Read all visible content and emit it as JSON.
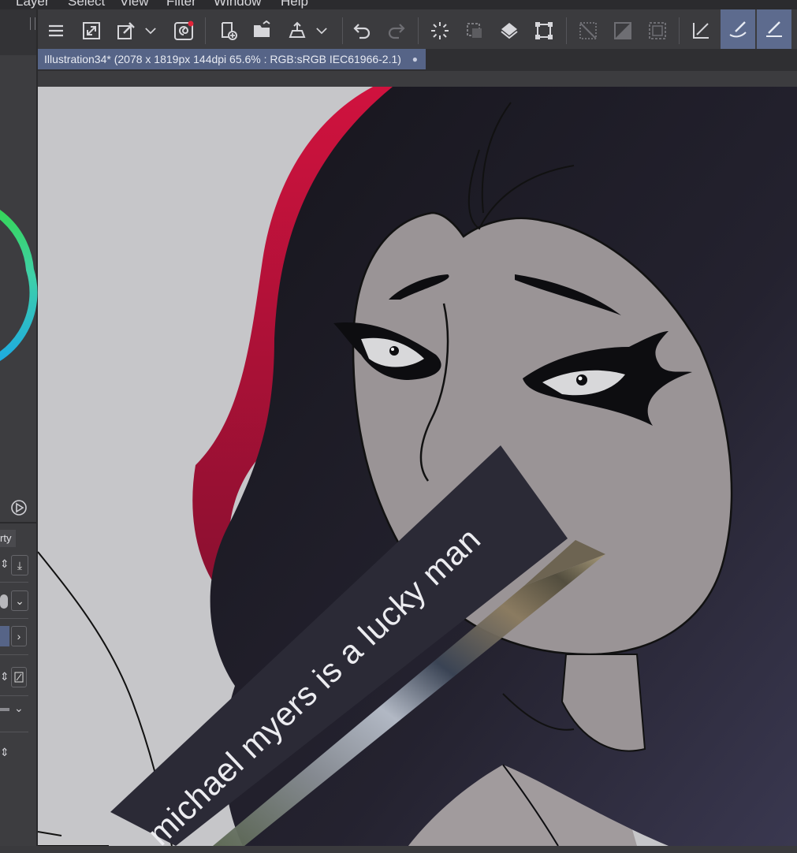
{
  "menu": {
    "items": [
      "Layer",
      "Select",
      "View",
      "Filter",
      "Window",
      "Help"
    ]
  },
  "toolbar": {
    "icons": [
      "menu-icon",
      "resize-canvas-icon",
      "eyedropper-settings-icon",
      "chevron-down-icon",
      "swirl-icon",
      "new-file-icon",
      "open-folder-icon",
      "export-icon",
      "chevron-down-icon",
      "undo-icon",
      "redo-icon",
      "loading-spinner-icon",
      "selection-dashed-icon",
      "fill-bucket-icon",
      "transform-icon",
      "clear-outside-icon",
      "gradient-fill-icon",
      "selection-border-icon",
      "snap-ruler-icon",
      "pen-snap-icon",
      "ruler-pen-icon"
    ]
  },
  "document": {
    "tab_title": "Illustration34* (2078 x 1819px 144dpi 65.6% : RGB:sRGB IEC61966-2.1)",
    "tab_close": "●"
  },
  "left_panel": {
    "property_label": "rty",
    "download_symbol": "⤓",
    "chevron": "⌄",
    "arrow_right": "›",
    "updown": "⇕"
  },
  "caption": {
    "text": "michael myers is a lucky man"
  },
  "colors": {
    "accent": "#566487",
    "active_tool": "#5d6b8e",
    "hair": "#1f1d2a",
    "skin": "#9a9496",
    "highlight_red": "#c0163a",
    "caption_bg": "#2b2a36"
  }
}
